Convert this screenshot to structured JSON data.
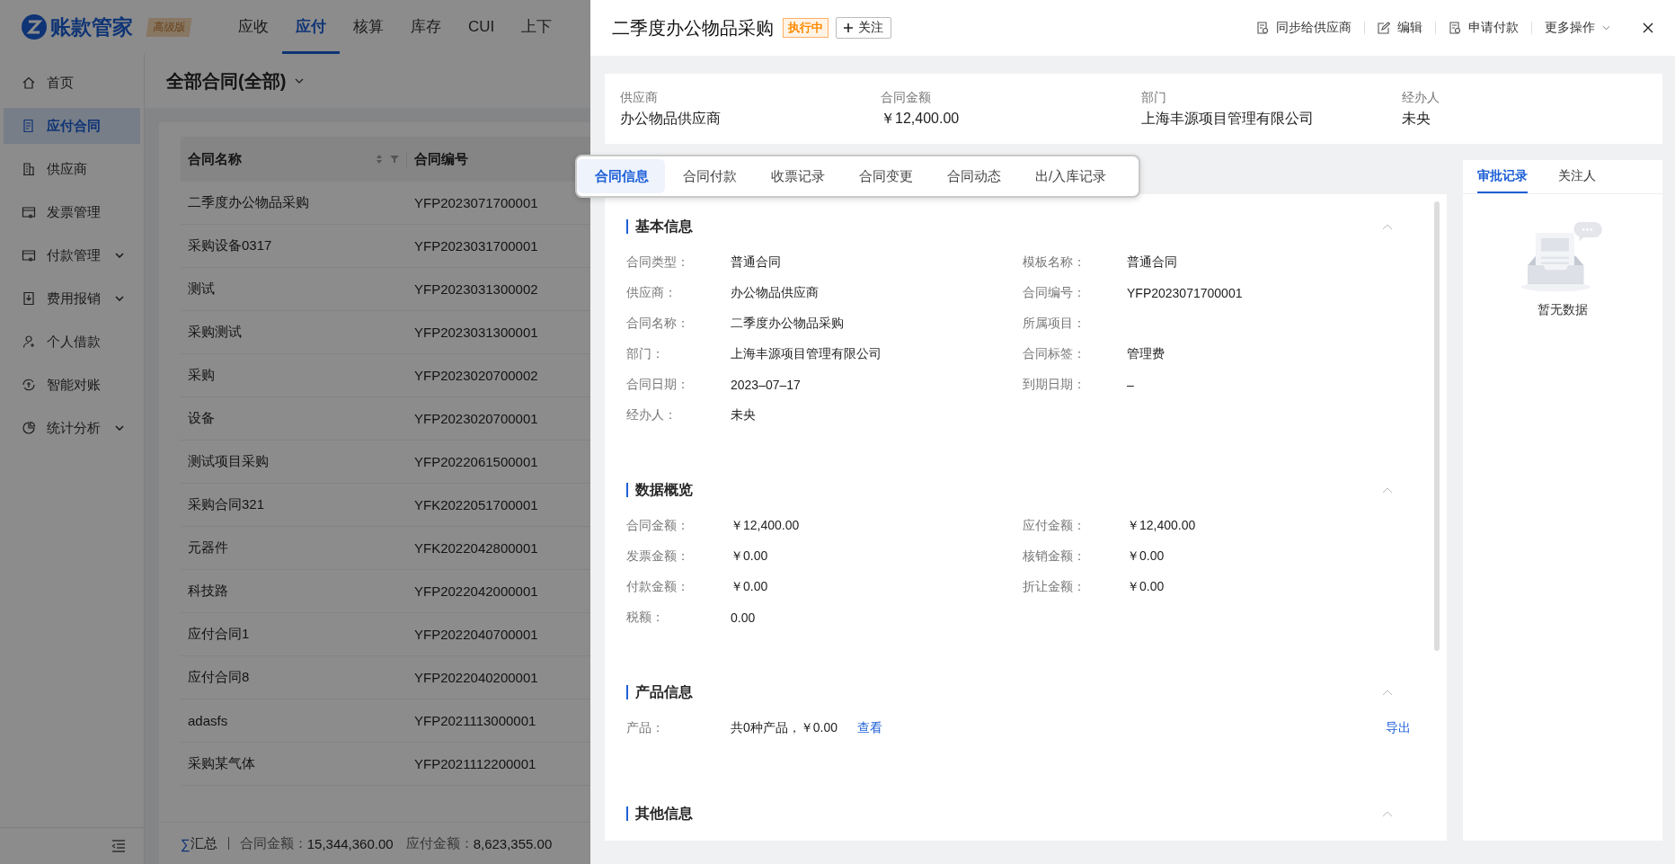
{
  "app": {
    "logo_text": "账款管家",
    "edition": "高级版"
  },
  "top_nav": [
    {
      "label": "应收",
      "selected": false
    },
    {
      "label": "应付",
      "selected": true
    },
    {
      "label": "核算",
      "selected": false
    },
    {
      "label": "库存",
      "selected": false
    },
    {
      "label": "CUI",
      "selected": false
    },
    {
      "label": "上下",
      "selected": false
    }
  ],
  "sidebar": [
    {
      "label": "首页",
      "kind": "home",
      "selected": false,
      "expandable": false
    },
    {
      "label": "应付合同",
      "kind": "contract",
      "selected": true,
      "expandable": false
    },
    {
      "label": "供应商",
      "kind": "building",
      "selected": false,
      "expandable": false
    },
    {
      "label": "发票管理",
      "kind": "invoice",
      "selected": false,
      "expandable": false
    },
    {
      "label": "付款管理",
      "kind": "payment",
      "selected": false,
      "expandable": true
    },
    {
      "label": "费用报销",
      "kind": "expense",
      "selected": false,
      "expandable": true
    },
    {
      "label": "个人借款",
      "kind": "person",
      "selected": false,
      "expandable": false
    },
    {
      "label": "智能对账",
      "kind": "reconcile",
      "selected": false,
      "expandable": false
    },
    {
      "label": "统计分析",
      "kind": "chart",
      "selected": false,
      "expandable": true
    }
  ],
  "page": {
    "title": "全部合同(全部)"
  },
  "table": {
    "columns": [
      "合同名称",
      "合同编号"
    ],
    "rows": [
      [
        "二季度办公物品采购",
        "YFP2023071700001"
      ],
      [
        "采购设备0317",
        "YFP2023031700001"
      ],
      [
        "测试",
        "YFP2023031300002"
      ],
      [
        "采购测试",
        "YFP2023031300001"
      ],
      [
        "采购",
        "YFP2023020700002"
      ],
      [
        "设备",
        "YFP2023020700001"
      ],
      [
        "测试项目采购",
        "YFP2022061500001"
      ],
      [
        "采购合同321",
        "YFK2022051700001"
      ],
      [
        "元器件",
        "YFK2022042800001"
      ],
      [
        "科技路",
        "YFP2022042000001"
      ],
      [
        "应付合同1",
        "YFP2022040700001"
      ],
      [
        "应付合同8",
        "YFP2022040200001"
      ],
      [
        "adasfs",
        "YFP2021113000001"
      ],
      [
        "采购某气体",
        "YFP2021112200001"
      ]
    ]
  },
  "summary_bar": {
    "symbol": "∑",
    "label": "汇总",
    "items": [
      {
        "label": "合同金额：",
        "value": "15,344,360.00"
      },
      {
        "label": "应付金额：",
        "value": "8,623,355.00"
      }
    ]
  },
  "drawer": {
    "title": "二季度办公物品采购",
    "status": "执行中",
    "follow_label": "关注",
    "actions": [
      {
        "label": "同步给供应商",
        "kind": "sync"
      },
      {
        "label": "编辑",
        "kind": "edit"
      },
      {
        "label": "申请付款",
        "kind": "pay"
      },
      {
        "label": "更多操作",
        "kind": "more"
      }
    ],
    "header_fields": [
      {
        "label": "供应商",
        "value": "办公物品供应商"
      },
      {
        "label": "合同金额",
        "value": "￥12,400.00"
      },
      {
        "label": "部门",
        "value": "上海丰源项目管理有限公司"
      },
      {
        "label": "经办人",
        "value": "未央"
      }
    ],
    "tabs": [
      {
        "label": "合同信息",
        "selected": true
      },
      {
        "label": "合同付款",
        "selected": false
      },
      {
        "label": "收票记录",
        "selected": false
      },
      {
        "label": "合同变更",
        "selected": false
      },
      {
        "label": "合同动态",
        "selected": false
      },
      {
        "label": "出/入库记录",
        "selected": false
      }
    ],
    "sections": [
      {
        "title": "基本信息",
        "kind": "fields",
        "fields": [
          {
            "label": "合同类型：",
            "value": "普通合同"
          },
          {
            "label": "模板名称：",
            "value": "普通合同"
          },
          {
            "label": "供应商：",
            "value": "办公物品供应商"
          },
          {
            "label": "合同编号：",
            "value": "YFP2023071700001"
          },
          {
            "label": "合同名称：",
            "value": "二季度办公物品采购"
          },
          {
            "label": "所属项目："
          },
          {
            "label": "部门：",
            "value": "上海丰源项目管理有限公司"
          },
          {
            "label": "合同标签：",
            "value": "管理费"
          },
          {
            "label": "合同日期：",
            "value": "2023–07–17"
          },
          {
            "label": "到期日期：",
            "value": "–"
          },
          {
            "label": "经办人：",
            "value": "未央"
          }
        ]
      },
      {
        "title": "数据概览",
        "kind": "fields",
        "fields": [
          {
            "label": "合同金额：",
            "value": "￥12,400.00"
          },
          {
            "label": "应付金额：",
            "value": "￥12,400.00"
          },
          {
            "label": "发票金额：",
            "value": "￥0.00"
          },
          {
            "label": "核销金额：",
            "value": "￥0.00"
          },
          {
            "label": "付款金额：",
            "value": "￥0.00"
          },
          {
            "label": "折让金额：",
            "value": "￥0.00"
          },
          {
            "label": "税额：",
            "value": "0.00"
          }
        ]
      },
      {
        "title": "产品信息",
        "kind": "product",
        "label": "产品：",
        "value": "共0种产品，￥0.00",
        "link": "查看",
        "export": "导出"
      },
      {
        "title": "其他信息",
        "kind": "empty"
      }
    ],
    "side_tabs": [
      {
        "label": "审批记录",
        "selected": true
      },
      {
        "label": "关注人",
        "selected": false
      }
    ],
    "empty_text": "暂无数据"
  }
}
